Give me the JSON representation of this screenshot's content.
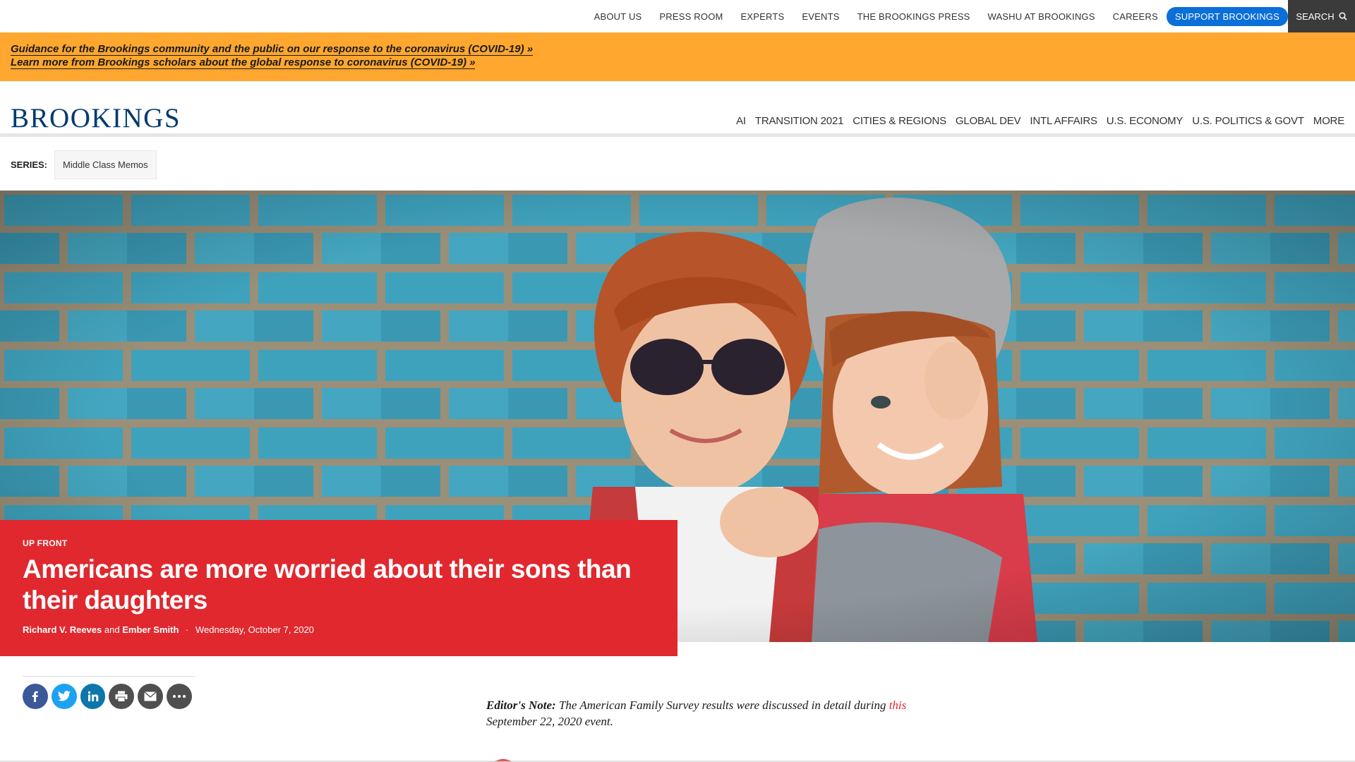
{
  "utility_nav": {
    "links": [
      "ABOUT US",
      "PRESS ROOM",
      "EXPERTS",
      "EVENTS",
      "THE BROOKINGS PRESS",
      "WASHU AT BROOKINGS",
      "CAREERS"
    ],
    "support_label": "SUPPORT BROOKINGS",
    "search_label": "SEARCH",
    "search_icon": "search-icon"
  },
  "alert": {
    "line1": "Guidance for the Brookings community and the public on our response to the coronavirus (COVID-19) »",
    "line2": "Learn more from Brookings scholars about the global response to coronavirus (COVID-19) »"
  },
  "header": {
    "logo": "BROOKINGS",
    "nav": [
      "AI",
      "TRANSITION 2021",
      "CITIES & REGIONS",
      "GLOBAL DEV",
      "INTL AFFAIRS",
      "U.S. ECONOMY",
      "U.S. POLITICS & GOVT",
      "MORE"
    ]
  },
  "series": {
    "label": "SERIES:",
    "name": "Middle Class Memos"
  },
  "article": {
    "kicker": "UP FRONT",
    "title": "Americans are more worried about their sons than their daughters",
    "author1": "Richard V. Reeves",
    "and": "and",
    "author2": "Ember Smith",
    "date_sep": "·",
    "date": "Wednesday, October 7, 2020"
  },
  "share": {
    "icons": [
      "facebook-icon",
      "twitter-icon",
      "linkedin-icon",
      "print-icon",
      "email-icon",
      "more-icon"
    ]
  },
  "editors_note": {
    "label": "Editor's Note:",
    "text_before": "The American Family Survey results were discussed in detail during",
    "link": "this",
    "text_after": "September 22, 2020 event."
  },
  "colors": {
    "alert_bg": "#ffa72e",
    "brand_red": "#e0282e",
    "brand_blue": "#003a70",
    "support_blue": "#0a6fd9"
  }
}
